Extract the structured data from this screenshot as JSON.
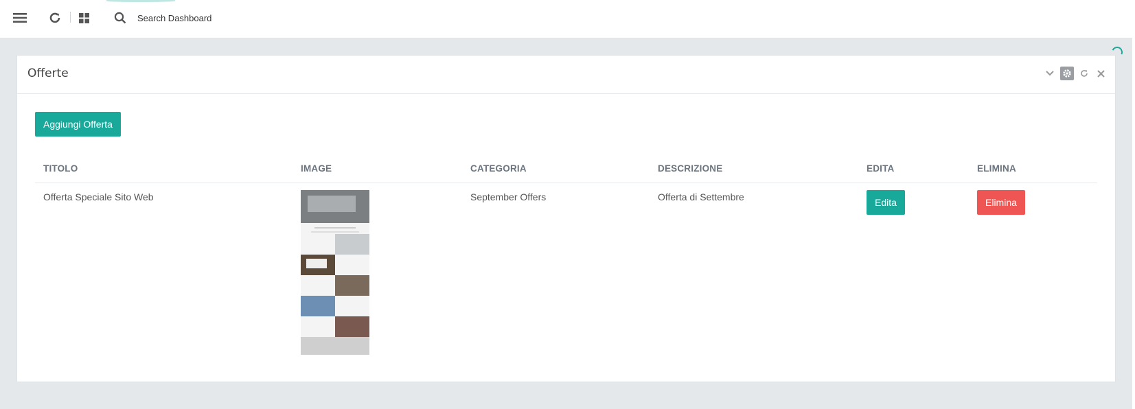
{
  "topbar": {
    "search_label": "Search Dashboard",
    "icons": [
      "menu-icon",
      "refresh-icon",
      "grid-icon",
      "search-icon"
    ]
  },
  "panel": {
    "title": "Offerte",
    "tools": [
      "chevron-down-icon",
      "gear-icon",
      "refresh-icon",
      "close-icon"
    ]
  },
  "add_button": "Aggiungi Offerta",
  "table": {
    "headers": [
      "TITOLO",
      "IMAGE",
      "CATEGORIA",
      "DESCRIZIONE",
      "EDITA",
      "ELIMINA"
    ],
    "rows": [
      {
        "titolo": "Offerta Speciale Sito Web",
        "image": "offer-thumbnail",
        "categoria": "September Offers",
        "descrizione": "Offerta di Settembre",
        "edit_label": "Edita",
        "delete_label": "Elimina"
      }
    ]
  },
  "colors": {
    "accent": "#18a99a",
    "danger": "#ef5553",
    "background": "#e5e8eb"
  }
}
